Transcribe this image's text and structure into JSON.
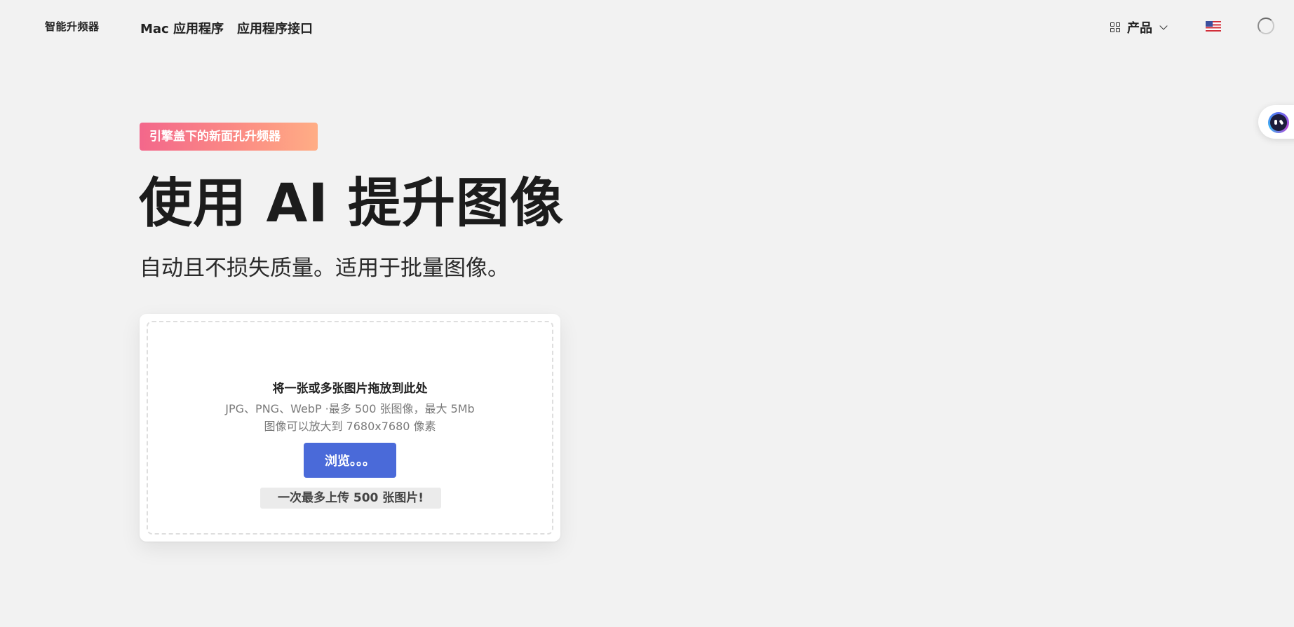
{
  "header": {
    "logo": "智能升频器",
    "nav": {
      "mac_app": "Mac 应用程序",
      "api": "应用程序接口"
    },
    "product_menu": {
      "label": "产品",
      "icon": "grid-icon",
      "chevron": "chevron-down-icon"
    },
    "language_icon": "us-flag-icon",
    "account_icon": "loading-spinner-icon"
  },
  "hero": {
    "badge": "引擎盖下的新面孔升频器",
    "title": "使用 AI 提升图像",
    "subtitle": "自动且不损失质量。适用于批量图像。"
  },
  "upload": {
    "title": "将一张或多张图片拖放到此处",
    "formats": "JPG、PNG、WebP ·最多 500 张图像，最大 5Mb",
    "max_size": "图像可以放大到 7680x7680 像素",
    "browse_label": "浏览。。。",
    "note": "一次最多上传 500 张图片!"
  },
  "colors": {
    "background": "#f2f2f2",
    "accent_button": "#4a6ad9",
    "badge_gradient_start": "#f3678b",
    "badge_gradient_end": "#ffad85"
  },
  "assistant": {
    "icon": "assistant-bot-icon"
  }
}
